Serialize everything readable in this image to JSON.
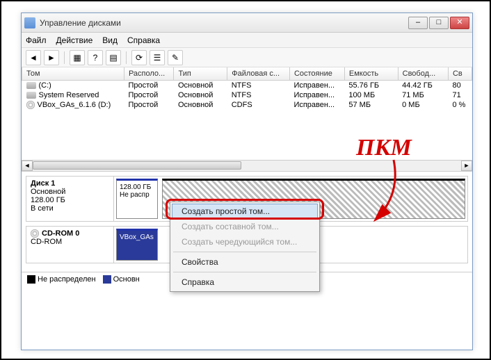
{
  "window": {
    "title": "Управление дисками"
  },
  "menu": {
    "file": "Файл",
    "action": "Действие",
    "view": "Вид",
    "help": "Справка"
  },
  "columns": {
    "vol": "Том",
    "layout": "Располо...",
    "type": "Тип",
    "fs": "Файловая с...",
    "status": "Состояние",
    "cap": "Емкость",
    "free": "Свобод...",
    "pct": "Св"
  },
  "rows": [
    {
      "vol": "(C:)",
      "layout": "Простой",
      "type": "Основной",
      "fs": "NTFS",
      "status": "Исправен...",
      "cap": "55.76 ГБ",
      "free": "44.42 ГБ",
      "pct": "80",
      "icon": "hdd"
    },
    {
      "vol": "System Reserved",
      "layout": "Простой",
      "type": "Основной",
      "fs": "NTFS",
      "status": "Исправен...",
      "cap": "100 МБ",
      "free": "71 МБ",
      "pct": "71",
      "icon": "hdd"
    },
    {
      "vol": "VBox_GAs_6.1.6 (D:)",
      "layout": "Простой",
      "type": "Основной",
      "fs": "CDFS",
      "status": "Исправен...",
      "cap": "57 МБ",
      "free": "0 МБ",
      "pct": "0 %",
      "icon": "cd"
    }
  ],
  "disk1": {
    "header": "Диск 1",
    "type": "Основной",
    "size": "128.00 ГБ",
    "status": "В сети",
    "part_size": "128.00 ГБ",
    "part_status": "Не распр"
  },
  "cdrom": {
    "header": "CD-ROM 0",
    "type": "CD-ROM",
    "status": "Не распределен",
    "vol": "VBox_GAs",
    "part": "Основн"
  },
  "ctx": {
    "simple": "Создать простой том...",
    "spanned": "Создать составной том...",
    "striped": "Создать чередующийся том...",
    "props": "Свойства",
    "help": "Справка"
  },
  "annotation": "ПКМ"
}
